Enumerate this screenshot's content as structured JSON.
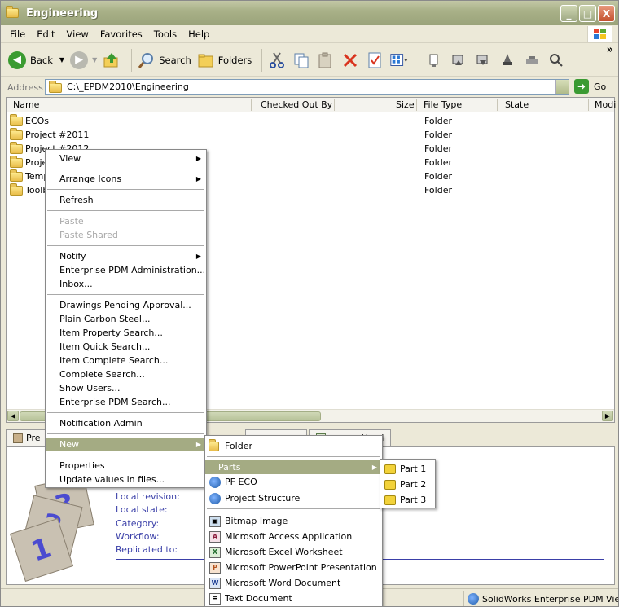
{
  "window": {
    "title": "Engineering",
    "caption_buttons": [
      "_",
      "□",
      "X"
    ]
  },
  "menubar": [
    "File",
    "Edit",
    "View",
    "Favorites",
    "Tools",
    "Help"
  ],
  "toolbar": {
    "back": "Back",
    "search": "Search",
    "folders": "Folders",
    "overflow": "»"
  },
  "address": {
    "label": "Address",
    "value": "C:\\_EPDM2010\\Engineering",
    "go": "Go"
  },
  "columns": [
    "Name",
    "Checked Out By",
    "Size",
    "File Type",
    "State",
    "Modi"
  ],
  "files": [
    {
      "name": "ECOs",
      "type": "Folder"
    },
    {
      "name": "Project #2011",
      "type": "Folder"
    },
    {
      "name": "Project #2012",
      "type": "Folder"
    },
    {
      "name": "Proje",
      "type": "Folder"
    },
    {
      "name": "Temp",
      "type": "Folder"
    },
    {
      "name": "Toolb",
      "type": "Folder"
    }
  ],
  "context_menu": {
    "items": [
      {
        "label": "View",
        "submenu": true
      },
      {
        "label": "Arrange Icons",
        "submenu": true
      },
      {
        "label": "Refresh"
      },
      {
        "label": "Paste",
        "disabled": true
      },
      {
        "label": "Paste Shared",
        "disabled": true
      },
      {
        "label": "Notify",
        "submenu": true
      },
      {
        "label": "Enterprise PDM Administration..."
      },
      {
        "label": "Inbox..."
      },
      {
        "label": "Drawings Pending Approval..."
      },
      {
        "label": "Plain Carbon Steel..."
      },
      {
        "label": "Item Property Search..."
      },
      {
        "label": "Item Quick Search..."
      },
      {
        "label": "Item Complete Search..."
      },
      {
        "label": "Complete Search..."
      },
      {
        "label": "Show Users..."
      },
      {
        "label": "Enterprise PDM Search..."
      },
      {
        "label": "Notification Admin"
      },
      {
        "label": "New",
        "submenu": true,
        "active": true
      },
      {
        "label": "Properties"
      },
      {
        "label": "Update values in files..."
      }
    ]
  },
  "new_submenu": {
    "items": [
      {
        "label": "Folder",
        "icon": "folder-icon"
      },
      {
        "label": "Parts",
        "icon": "none",
        "submenu": true,
        "active": true
      },
      {
        "label": "PF ECO",
        "icon": "pdm-icon"
      },
      {
        "label": "Project Structure",
        "icon": "pdm-icon"
      },
      {
        "label": "Bitmap Image",
        "icon": "bitmap-icon"
      },
      {
        "label": "Microsoft Access Application",
        "icon": "access-icon"
      },
      {
        "label": "Microsoft Excel Worksheet",
        "icon": "excel-icon"
      },
      {
        "label": "Microsoft PowerPoint Presentation",
        "icon": "powerpoint-icon"
      },
      {
        "label": "Microsoft Word Document",
        "icon": "word-icon"
      },
      {
        "label": "Text Document",
        "icon": "text-icon"
      }
    ]
  },
  "parts_submenu": {
    "items": [
      {
        "label": "Part 1"
      },
      {
        "label": "Part 2"
      },
      {
        "label": "Part 3"
      }
    ]
  },
  "preview": {
    "tabs": [
      "Pre",
      "",
      "e Used"
    ],
    "fields": [
      "Local revision:",
      "Local state:",
      "Category:",
      "Workflow:",
      "Replicated to:"
    ]
  },
  "status": {
    "text": "SolidWorks Enterprise PDM Vie"
  },
  "colors": {
    "title_gradient": "#a9b188",
    "menu_highlight": "#a4ab83",
    "link_blue": "#3a3fa8"
  }
}
